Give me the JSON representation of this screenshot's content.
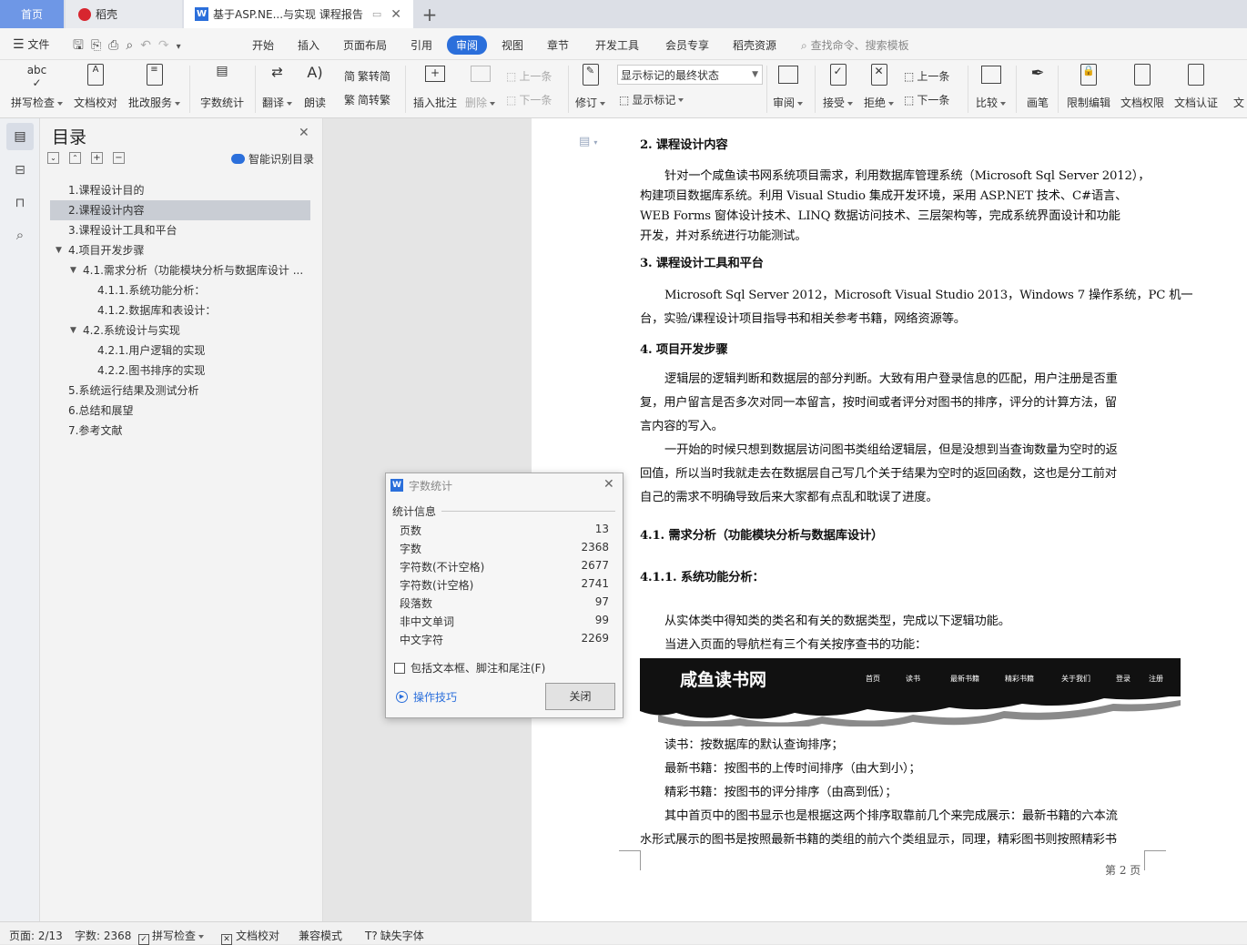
{
  "tabs": {
    "home": "首页",
    "docer": "稻壳",
    "doc_title": "基于ASP.NE...与实现 课程报告",
    "new_tab": "+"
  },
  "menu": {
    "file": "文件",
    "items": [
      "开始",
      "插入",
      "页面布局",
      "引用",
      "审阅",
      "视图",
      "章节",
      "开发工具",
      "会员专享",
      "稻壳资源"
    ],
    "search": "查找命令、搜索模板"
  },
  "toolbar": {
    "spell": "拼写检查",
    "proof": "文档校对",
    "revise_service": "批改服务",
    "word_count": "字数统计",
    "translate": "翻译",
    "read": "朗读",
    "to_trad": "繁转简",
    "to_simp": "简转繁",
    "insert_comment": "插入批注",
    "delete": "删除",
    "prev": "上一条",
    "next": "下一条",
    "revise": "修订",
    "markup_state": "显示标记的最终状态",
    "show_markup": "显示标记",
    "review": "审阅",
    "accept": "接受",
    "reject": "拒绝",
    "prev2": "上一条",
    "next2": "下一条",
    "compare": "比较",
    "pen": "画笔",
    "restrict": "限制编辑",
    "doc_rights": "文档权限",
    "doc_cert": "文档认证",
    "more": "文"
  },
  "toc": {
    "title": "目录",
    "smart": "智能识别目录",
    "items": [
      "1.课程设计目的",
      "2.课程设计内容",
      "3.课程设计工具和平台",
      "4.项目开发步骤",
      "4.1.需求分析（功能模块分析与数据库设计 ...",
      "4.1.1.系统功能分析：",
      "4.1.2.数据库和表设计：",
      "4.2.系统设计与实现",
      "4.2.1.用户逻辑的实现",
      "4.2.2.图书排序的实现",
      "5.系统运行结果及测试分析",
      "6.总结和展望",
      "7.参考文献"
    ]
  },
  "document": {
    "h2": "2.    课程设计内容",
    "p1": [
      "针对一个咸鱼读书网系统项目需求，利用数据库管理系统（Microsoft  Sql  Server  2012），",
      "构建项目数据库系统。利用  Visual  Studio  集成开发环境，采用 ASP.NET 技术、C#语言、",
      "WEB  Forms 窗体设计技术、LINQ 数据访问技术、三层架构等，完成系统界面设计和功能",
      "开发，并对系统进行功能测试。"
    ],
    "h3": "3.    课程设计工具和平台",
    "p2": [
      "Microsoft Sql Server 2012，Microsoft Visual Studio 2013，Windows 7 操作系统，PC 机一",
      "台，实验/课程设计项目指导书和相关参考书籍，网络资源等。"
    ],
    "h4": "4.    项目开发步骤",
    "p3": [
      "逻辑层的逻辑判断和数据层的部分判断。大致有用户登录信息的匹配，用户注册是否重",
      "复，用户留言是否多次对同一本留言，按时间或者评分对图书的排序，评分的计算方法，留",
      "言内容的写入。"
    ],
    "p4": [
      "一开始的时候只想到数据层访问图书类组给逻辑层，但是没想到当查询数量为空时的返",
      "回值，所以当时我就走去在数据层自己写几个关于结果为空时的返回函数，这也是分工前对",
      "自己的需求不明确导致后来大家都有点乱和耽误了进度。"
    ],
    "h41": "4.1.    需求分析（功能模块分析与数据库设计）",
    "h411": "4.1.1.    系统功能分析：",
    "p5": "从实体类中得知类的类名和有关的数据类型，完成以下逻辑功能。",
    "p6": "当进入页面的导航栏有三个有关按序查书的功能：",
    "banner": {
      "title": "咸鱼读书网",
      "nav": [
        "首页",
        "读书",
        "最新书籍",
        "精彩书籍",
        "关于我们",
        "登录",
        "注册"
      ]
    },
    "p7": "读书：按数据库的默认查询排序；",
    "p8": "最新书籍：按图书的上传时间排序（由大到小）；",
    "p9": "精彩书籍：按图书的评分排序（由高到低）；",
    "p10": [
      "其中首页中的图书显示也是根据这两个排序取靠前几个来完成展示：最新书籍的六本流",
      "水形式展示的图书是按照最新书籍的类组的前六个类组显示，同理，精彩图书则按照精彩书"
    ],
    "page_no": "第 2 页"
  },
  "dialog": {
    "title": "字数统计",
    "section": "统计信息",
    "rows": [
      {
        "k": "页数",
        "v": "13"
      },
      {
        "k": "字数",
        "v": "2368"
      },
      {
        "k": "字符数(不计空格)",
        "v": "2677"
      },
      {
        "k": "字符数(计空格)",
        "v": "2741"
      },
      {
        "k": "段落数",
        "v": "97"
      },
      {
        "k": "非中文单词",
        "v": "99"
      },
      {
        "k": "中文字符",
        "v": "2269"
      }
    ],
    "include": "包括文本框、脚注和尾注(F)",
    "tips": "操作技巧",
    "close": "关闭"
  },
  "status": {
    "page": "页面: 2/13",
    "words": "字数: 2368",
    "spell": "拼写检查",
    "proof": "文档校对",
    "compat": "兼容模式",
    "missing_font": "缺失字体"
  },
  "colors": {
    "accent": "#2b6fdb",
    "wps_red": "#d7262f",
    "selected": "#c9cdd4"
  }
}
